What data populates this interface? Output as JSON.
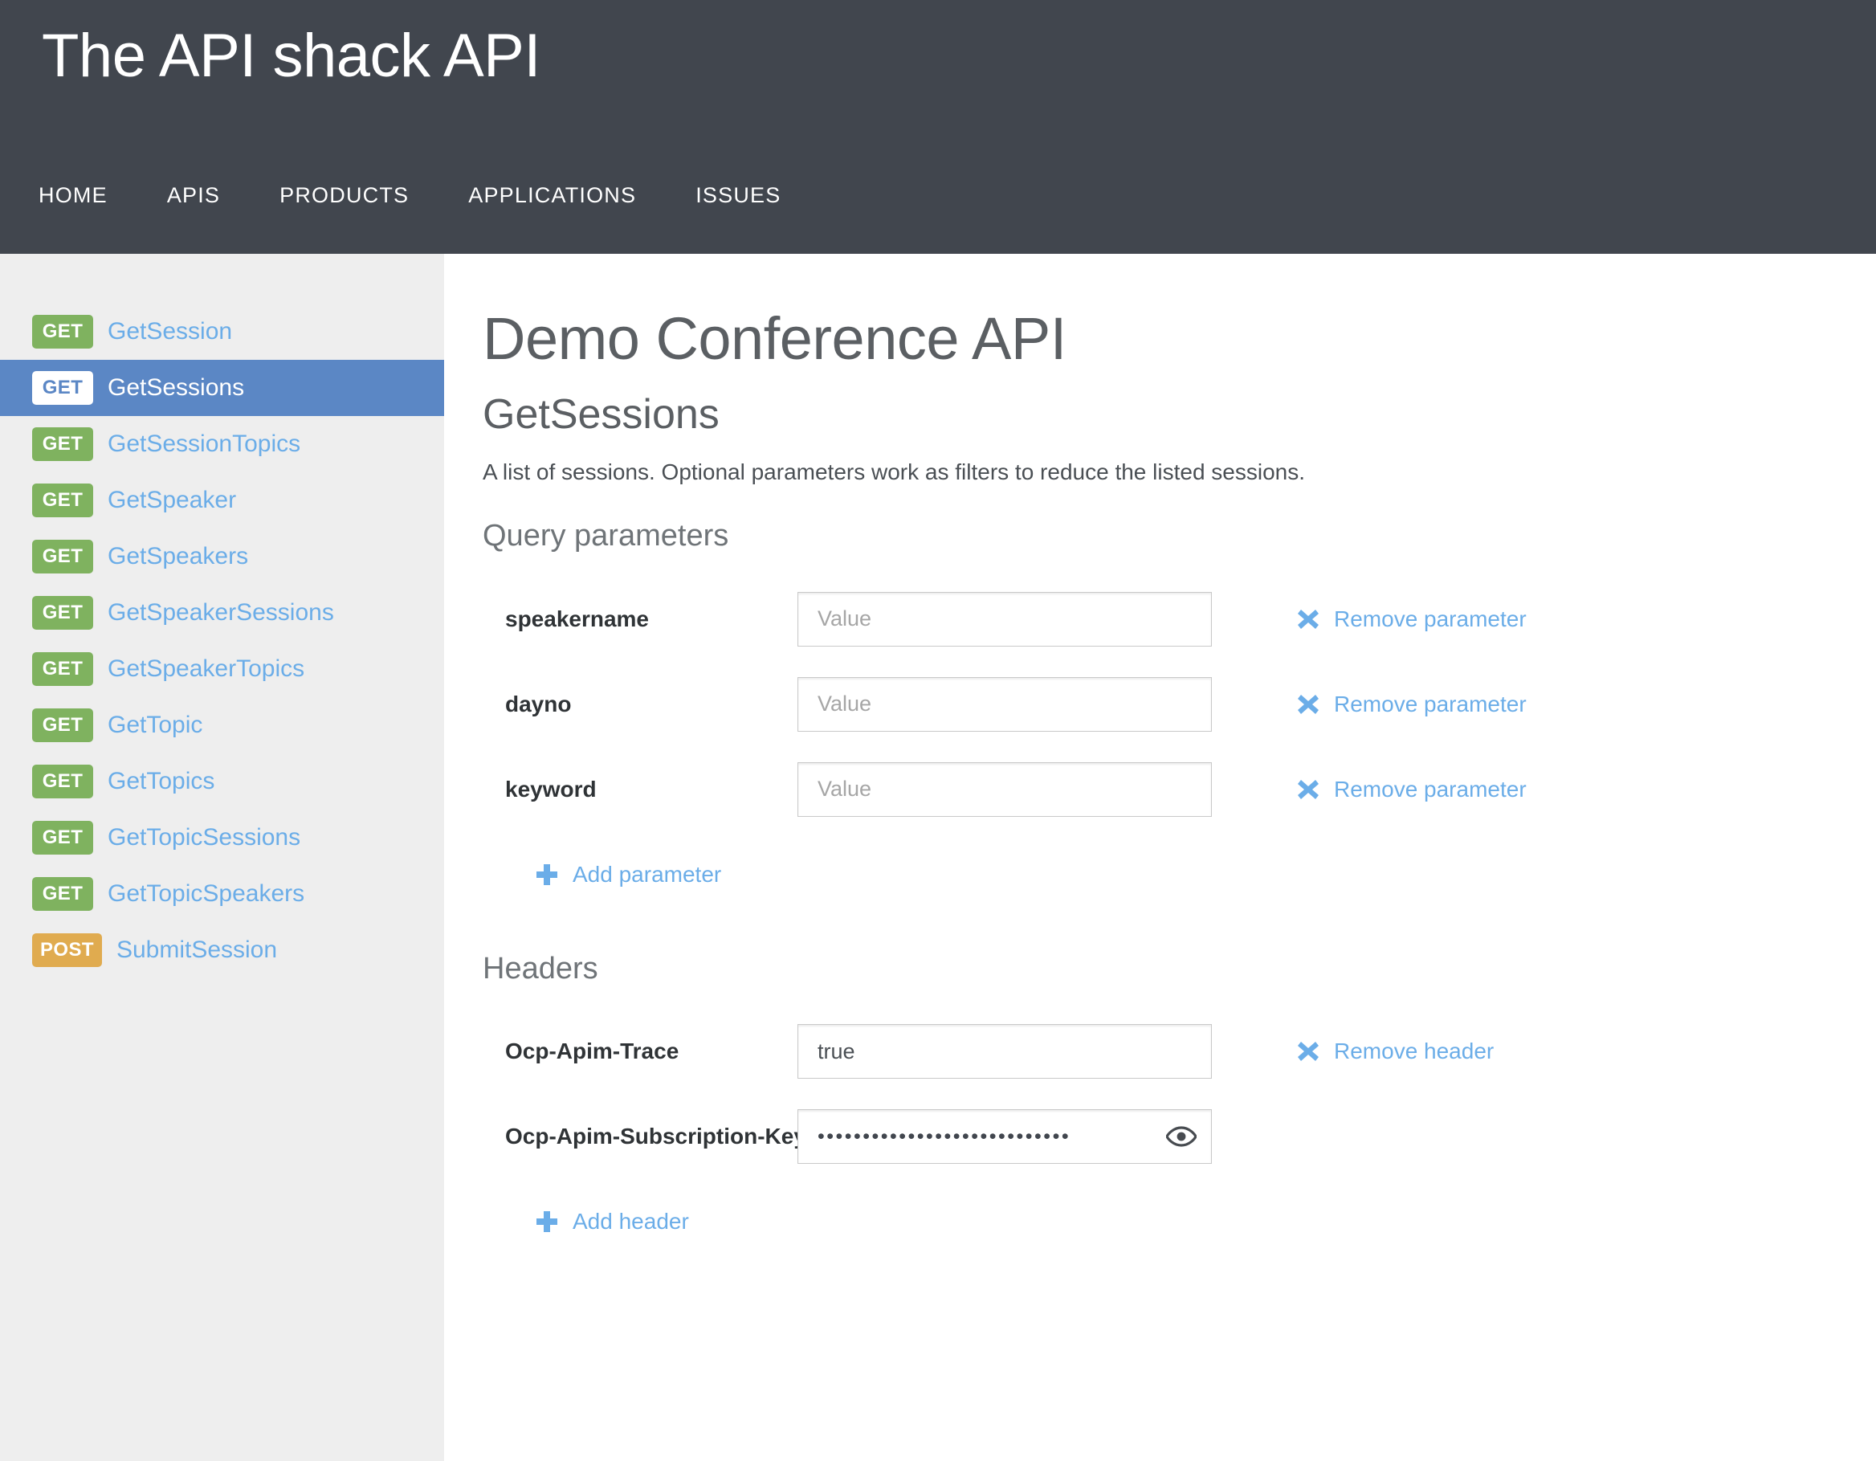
{
  "header": {
    "site_title": "The API shack API",
    "nav": [
      {
        "label": "HOME"
      },
      {
        "label": "APIS"
      },
      {
        "label": "PRODUCTS"
      },
      {
        "label": "APPLICATIONS"
      },
      {
        "label": "ISSUES"
      }
    ]
  },
  "sidebar": {
    "operations": [
      {
        "method": "GET",
        "name": "GetSession",
        "selected": false
      },
      {
        "method": "GET",
        "name": "GetSessions",
        "selected": true
      },
      {
        "method": "GET",
        "name": "GetSessionTopics",
        "selected": false
      },
      {
        "method": "GET",
        "name": "GetSpeaker",
        "selected": false
      },
      {
        "method": "GET",
        "name": "GetSpeakers",
        "selected": false
      },
      {
        "method": "GET",
        "name": "GetSpeakerSessions",
        "selected": false
      },
      {
        "method": "GET",
        "name": "GetSpeakerTopics",
        "selected": false
      },
      {
        "method": "GET",
        "name": "GetTopic",
        "selected": false
      },
      {
        "method": "GET",
        "name": "GetTopics",
        "selected": false
      },
      {
        "method": "GET",
        "name": "GetTopicSessions",
        "selected": false
      },
      {
        "method": "GET",
        "name": "GetTopicSpeakers",
        "selected": false
      },
      {
        "method": "POST",
        "name": "SubmitSession",
        "selected": false
      }
    ]
  },
  "main": {
    "api_title": "Demo Conference API",
    "operation_title": "GetSessions",
    "operation_description": "A list of sessions. Optional parameters work as filters to reduce the listed sessions.",
    "query_parameters": {
      "section_title": "Query parameters",
      "rows": [
        {
          "label": "speakername",
          "value": "",
          "placeholder": "Value",
          "remove_label": "Remove parameter"
        },
        {
          "label": "dayno",
          "value": "",
          "placeholder": "Value",
          "remove_label": "Remove parameter"
        },
        {
          "label": "keyword",
          "value": "",
          "placeholder": "Value",
          "remove_label": "Remove parameter"
        }
      ],
      "add_label": "Add parameter"
    },
    "headers": {
      "section_title": "Headers",
      "rows": [
        {
          "label": "Ocp-Apim-Trace",
          "value": "true",
          "placeholder": "Value",
          "masked": false,
          "remove_label": "Remove header"
        },
        {
          "label": "Ocp-Apim-Subscription-Key",
          "value": "••••••••••••••••••••••••••••",
          "placeholder": "Value",
          "masked": true,
          "remove_label": ""
        }
      ],
      "add_label": "Add header"
    }
  },
  "icons": {
    "remove": "x-icon",
    "add": "plus-icon",
    "reveal": "eye-icon"
  },
  "colors": {
    "header_bg": "#41464e",
    "sidebar_bg": "#eeeeee",
    "selected_bg": "#5b87c5",
    "link_blue": "#6bade8",
    "get_green": "#7fb25f",
    "post_orange": "#e0ab4f",
    "text_dark": "#2f3336",
    "heading_gray": "#5b5f63"
  }
}
